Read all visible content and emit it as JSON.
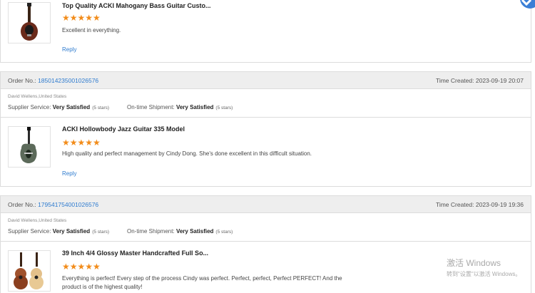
{
  "reviews": [
    {
      "product_title": "Top Quality ACKI Mahogany Bass Guitar Custo...",
      "rating_stars": 5,
      "stars_text": "★★★★★",
      "comment": "Excellent in everything.",
      "reply_label": "Reply"
    },
    {
      "order_label": "Order No.:",
      "order_no": "185014235001026576",
      "time_label": "Time Created:",
      "time_created": "2023-09-19 20:07",
      "buyer": "David Wellens,United States",
      "supplier_label": "Supplier Service:",
      "supplier_value": "Very Satisfied",
      "supplier_stars": "(5 stars)",
      "shipment_label": "On-time Shipment:",
      "shipment_value": "Very Satisfied",
      "shipment_stars": "(5 stars)",
      "product_title": "ACKI Hollowbody Jazz Guitar 335 Model",
      "rating_stars": 5,
      "stars_text": "★★★★★",
      "comment": "High quality and perfect management by Cindy Dong.  She's done excellent in this difficult situation.",
      "reply_label": "Reply"
    },
    {
      "order_label": "Order No.:",
      "order_no": "179541754001026576",
      "time_label": "Time Created:",
      "time_created": "2023-09-19 19:36",
      "buyer": "David Wellens,United States",
      "supplier_label": "Supplier Service:",
      "supplier_value": "Very Satisfied",
      "supplier_stars": "(5 stars)",
      "shipment_label": "On-time Shipment:",
      "shipment_value": "Very Satisfied",
      "shipment_stars": "(5 stars)",
      "product_title": "39 Inch 4/4 Glossy Master Handcrafted Full So...",
      "rating_stars": 5,
      "stars_text": "★★★★★",
      "comment": "Everything is perfect!  Every step of the process Cindy was perfect. Perfect, perfect, Perfect PERFECT!  And the product is of the highest quality!"
    }
  ],
  "watermark": {
    "line1": "激活 Windows",
    "line2": "转到\"设置\"以激活 Windows。"
  },
  "icons": {
    "corner": "blue-arrow-icon",
    "thumb1": "bass-guitar-icon",
    "thumb2": "jazz-guitar-icon",
    "thumb3": "acoustic-guitars-icon"
  },
  "colors": {
    "accent": "#2e7bcf",
    "stars": "#f28c1a",
    "header_bg": "#eeeeee"
  }
}
